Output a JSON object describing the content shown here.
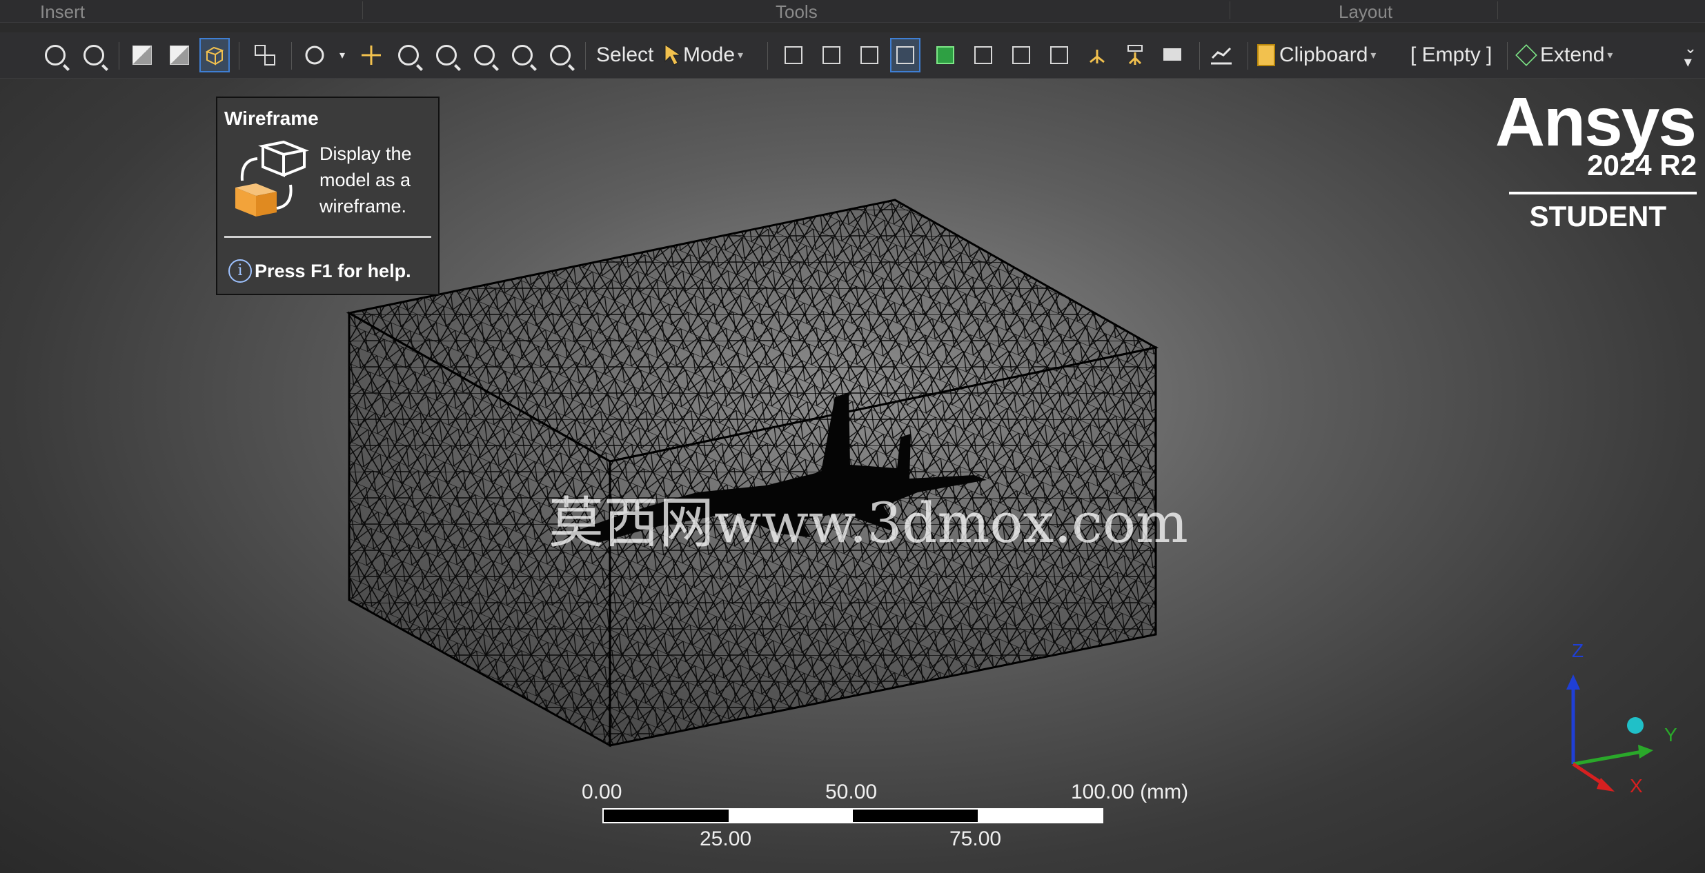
{
  "ribbon_groups": [
    "Insert",
    "Tools",
    "Layout"
  ],
  "toolbar": {
    "icons": [
      "zoom-extents-icon",
      "zoom-fit-icon",
      "shaded-solid-icon",
      "shaded-edges-icon",
      "wireframe-icon",
      "view-split-icon",
      "rotate-icon",
      "pan-icon",
      "zoom-icon",
      "zoom-box-icon",
      "zoom-fit-all-icon",
      "zoom-in-icon",
      "zoom-out-icon"
    ],
    "select_label": "Select",
    "mode_label": "Mode",
    "selection_icons": [
      "select-box-icon",
      "select-single-icon",
      "select-vertex-icon",
      "select-edge-icon",
      "select-face-icon",
      "select-body-icon",
      "select-element-icon",
      "select-node-icon",
      "select-coordinate-icon",
      "select-mesh-icon",
      "select-annotation-icon",
      "graph-icon"
    ],
    "clipboard_label": "Clipboard",
    "empty_label": "[ Empty ]",
    "extend_label": "Extend",
    "active_tool": "wireframe-icon"
  },
  "tooltip": {
    "title": "Wireframe",
    "body": "Display the model as a wireframe.",
    "help": "Press F1 for help.",
    "info_glyph": "i"
  },
  "logo": {
    "name": "Ansys",
    "version": "2024 R2",
    "edition": "STUDENT"
  },
  "watermark": "莫西网www.3dmox.com",
  "scale": {
    "top_labels": [
      "0.00",
      "50.00",
      "100.00 (mm)"
    ],
    "bottom_labels": [
      "25.00",
      "75.00"
    ]
  },
  "axes": {
    "z": "Z",
    "y": "Y",
    "x": "X",
    "z_color": "#1f3fd6",
    "y_color": "#2aa82a",
    "x_color": "#d62020"
  }
}
